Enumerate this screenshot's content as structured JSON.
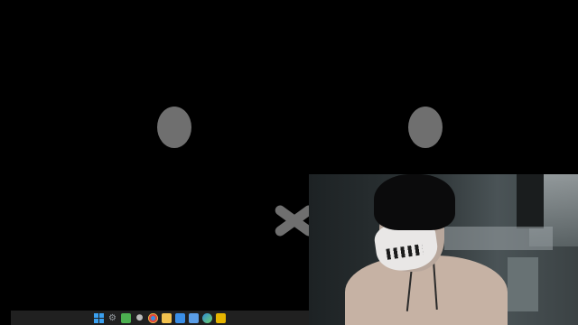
{
  "screen": {
    "background_color": "#000000",
    "face_color": "#6f6f6f"
  },
  "taskbar": {
    "icons": [
      {
        "name": "windows-start-icon",
        "color": "#3aa0f0"
      },
      {
        "name": "gear-icon",
        "color": "#9aa0a6"
      },
      {
        "name": "widgets-icon",
        "color": "#4caf50"
      },
      {
        "name": "search-icon",
        "color": "#bbbbbb"
      },
      {
        "name": "chrome-icon",
        "color": "#e04b3a"
      },
      {
        "name": "folder-icon",
        "color": "#f2c14e"
      },
      {
        "name": "photos-icon",
        "color": "#3a8ee6"
      },
      {
        "name": "store-icon",
        "color": "#5a9de6"
      },
      {
        "name": "edge-icon",
        "color": "#2e8bd8"
      },
      {
        "name": "app-icon",
        "color": "#e6b400"
      }
    ]
  },
  "webcam": {
    "subject": "person-with-mask"
  }
}
